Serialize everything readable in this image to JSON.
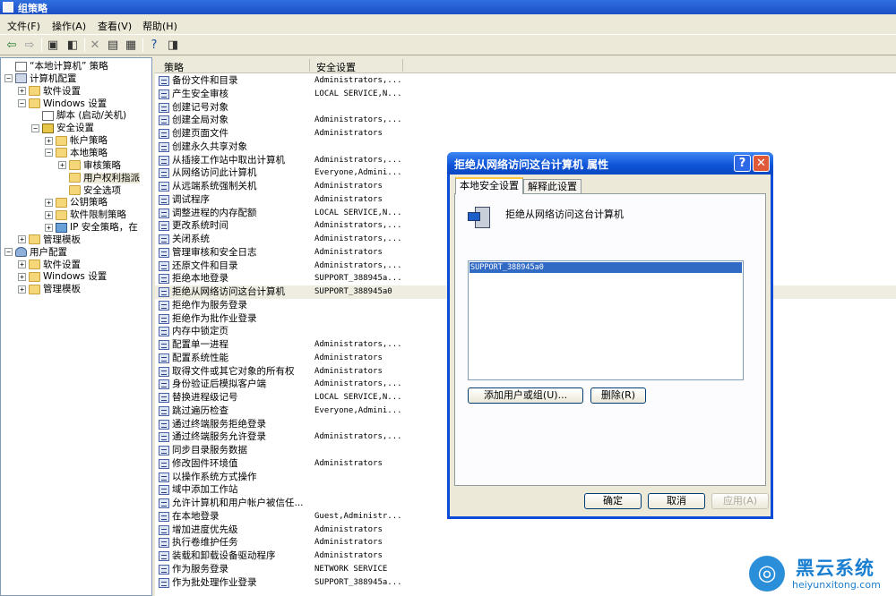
{
  "window": {
    "title": "组策略"
  },
  "menu": [
    "文件(F)",
    "操作(A)",
    "查看(V)",
    "帮助(H)"
  ],
  "toolbar": [
    "back-icon",
    "forward-icon",
    "up-icon",
    "show-tree-icon",
    "delete-icon",
    "properties-icon",
    "export-icon",
    "help-icon",
    "console-icon"
  ],
  "tree": [
    {
      "label": "“本地计算机” 策略",
      "level": 0,
      "icon": "doc",
      "exp": ""
    },
    {
      "label": "计算机配置",
      "level": 0,
      "icon": "comp",
      "exp": "-"
    },
    {
      "label": "软件设置",
      "level": 1,
      "icon": "folder",
      "exp": "+"
    },
    {
      "label": "Windows 设置",
      "level": 1,
      "icon": "folder",
      "exp": "-"
    },
    {
      "label": "脚本 (启动/关机)",
      "level": 2,
      "icon": "doc",
      "exp": ""
    },
    {
      "label": "安全设置",
      "level": 2,
      "icon": "shield",
      "exp": "-"
    },
    {
      "label": "帐户策略",
      "level": 3,
      "icon": "folder",
      "exp": "+"
    },
    {
      "label": "本地策略",
      "level": 3,
      "icon": "folder",
      "exp": "-"
    },
    {
      "label": "审核策略",
      "level": 4,
      "icon": "folder",
      "exp": "+"
    },
    {
      "label": "用户权利指派",
      "level": 4,
      "icon": "folder",
      "exp": "",
      "selected": true
    },
    {
      "label": "安全选项",
      "level": 4,
      "icon": "folder",
      "exp": ""
    },
    {
      "label": "公钥策略",
      "level": 3,
      "icon": "folder",
      "exp": "+"
    },
    {
      "label": "软件限制策略",
      "level": 3,
      "icon": "folder",
      "exp": "+"
    },
    {
      "label": "IP 安全策略，在",
      "level": 3,
      "icon": "net",
      "exp": "+"
    },
    {
      "label": "管理模板",
      "level": 1,
      "icon": "folder",
      "exp": "+"
    },
    {
      "label": "用户配置",
      "level": 0,
      "icon": "user",
      "exp": "-"
    },
    {
      "label": "软件设置",
      "level": 1,
      "icon": "folder",
      "exp": "+"
    },
    {
      "label": "Windows 设置",
      "level": 1,
      "icon": "folder",
      "exp": "+"
    },
    {
      "label": "管理模板",
      "level": 1,
      "icon": "folder",
      "exp": "+"
    }
  ],
  "list": {
    "col_policy": "策略",
    "col_setting": "安全设置",
    "rows": [
      {
        "policy": "备份文件和目录",
        "setting": "Administrators,..."
      },
      {
        "policy": "产生安全审核",
        "setting": "LOCAL SERVICE,N..."
      },
      {
        "policy": "创建记号对象",
        "setting": ""
      },
      {
        "policy": "创建全局对象",
        "setting": "Administrators,..."
      },
      {
        "policy": "创建页面文件",
        "setting": "Administrators"
      },
      {
        "policy": "创建永久共享对象",
        "setting": ""
      },
      {
        "policy": "从插接工作站中取出计算机",
        "setting": "Administrators,..."
      },
      {
        "policy": "从网络访问此计算机",
        "setting": "Everyone,Admini..."
      },
      {
        "policy": "从远端系统强制关机",
        "setting": "Administrators"
      },
      {
        "policy": "调试程序",
        "setting": "Administrators"
      },
      {
        "policy": "调整进程的内存配额",
        "setting": "LOCAL SERVICE,N..."
      },
      {
        "policy": "更改系统时间",
        "setting": "Administrators,..."
      },
      {
        "policy": "关闭系统",
        "setting": "Administrators,..."
      },
      {
        "policy": "管理审核和安全日志",
        "setting": "Administrators"
      },
      {
        "policy": "还原文件和目录",
        "setting": "Administrators,..."
      },
      {
        "policy": "拒绝本地登录",
        "setting": "SUPPORT_388945a..."
      },
      {
        "policy": "拒绝从网络访问这台计算机",
        "setting": "SUPPORT_388945a0",
        "highlight": true
      },
      {
        "policy": "拒绝作为服务登录",
        "setting": ""
      },
      {
        "policy": "拒绝作为批作业登录",
        "setting": ""
      },
      {
        "policy": "内存中锁定页",
        "setting": ""
      },
      {
        "policy": "配置单一进程",
        "setting": "Administrators,..."
      },
      {
        "policy": "配置系统性能",
        "setting": "Administrators"
      },
      {
        "policy": "取得文件或其它对象的所有权",
        "setting": "Administrators"
      },
      {
        "policy": "身份验证后模拟客户端",
        "setting": "Administrators,..."
      },
      {
        "policy": "替换进程级记号",
        "setting": "LOCAL SERVICE,N..."
      },
      {
        "policy": "跳过遍历检查",
        "setting": "Everyone,Admini..."
      },
      {
        "policy": "通过终端服务拒绝登录",
        "setting": ""
      },
      {
        "policy": "通过终端服务允许登录",
        "setting": "Administrators,..."
      },
      {
        "policy": "同步目录服务数据",
        "setting": ""
      },
      {
        "policy": "修改固件环境值",
        "setting": "Administrators"
      },
      {
        "policy": "以操作系统方式操作",
        "setting": ""
      },
      {
        "policy": "域中添加工作站",
        "setting": ""
      },
      {
        "policy": "允许计算机和用户帐户被信任...",
        "setting": ""
      },
      {
        "policy": "在本地登录",
        "setting": "Guest,Administr..."
      },
      {
        "policy": "增加进度优先级",
        "setting": "Administrators"
      },
      {
        "policy": "执行卷维护任务",
        "setting": "Administrators"
      },
      {
        "policy": "装载和卸载设备驱动程序",
        "setting": "Administrators"
      },
      {
        "policy": "作为服务登录",
        "setting": "NETWORK SERVICE"
      },
      {
        "policy": "作为批处理作业登录",
        "setting": "SUPPORT_388945a..."
      }
    ]
  },
  "dialog": {
    "title": "拒绝从网络访问这台计算机 属性",
    "help": "?",
    "close": "✕",
    "tab_local": "本地安全设置",
    "tab_explain": "解释此设置",
    "policy_name": "拒绝从网络访问这台计算机",
    "users": [
      "SUPPORT_388945a0"
    ],
    "btn_add": "添加用户或组(U)...",
    "btn_remove": "删除(R)",
    "btn_ok": "确定",
    "btn_cancel": "取消",
    "btn_apply": "应用(A)"
  },
  "watermark": {
    "name": "黑云系统",
    "url": "heiyunxitong.com"
  }
}
